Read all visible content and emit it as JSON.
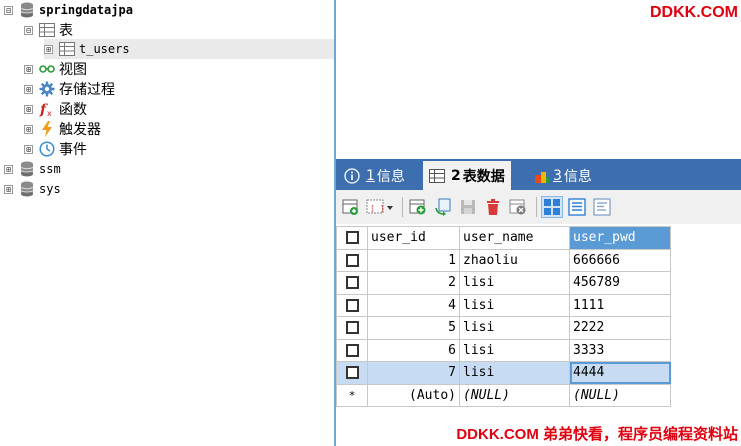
{
  "tree": {
    "database": "springdatajpa",
    "tables_folder": "表",
    "table": "t_users",
    "views": "视图",
    "procedures": "存储过程",
    "functions": "函数",
    "triggers": "触发器",
    "events": "事件",
    "db2": "ssm",
    "db3": "sys",
    "toggle_expanded": "⊟",
    "toggle_collapsed": "⊞"
  },
  "tabs": [
    {
      "num": "1",
      "label": "信息"
    },
    {
      "num": "2",
      "label": "表数据"
    },
    {
      "num": "3",
      "label": "信息"
    }
  ],
  "grid": {
    "columns": [
      "user_id",
      "user_name",
      "user_pwd"
    ],
    "highlighted_column": "user_pwd",
    "rows": [
      {
        "id": "1",
        "name": "zhaoliu",
        "pwd": "666666"
      },
      {
        "id": "2",
        "name": "lisi",
        "pwd": "456789"
      },
      {
        "id": "4",
        "name": "lisi",
        "pwd": "1111"
      },
      {
        "id": "5",
        "name": "lisi",
        "pwd": "2222"
      },
      {
        "id": "6",
        "name": "lisi",
        "pwd": "3333"
      },
      {
        "id": "7",
        "name": "lisi",
        "pwd": "4444"
      }
    ],
    "selected_row_id": "7",
    "new_row": {
      "marker": "*",
      "id": "(Auto)",
      "name": "(NULL)",
      "pwd": "(NULL)"
    }
  },
  "watermark": {
    "top": "DDKK.COM",
    "bottom": "DDKK.COM 弟弟快看，程序员编程资料站"
  },
  "colors": {
    "tab_band": "#3c6eb0",
    "divider": "#6fa5d8",
    "selected_row": "#c7dcf2",
    "header_highlight": "#5b9bd5",
    "watermark": "#e0000f"
  }
}
